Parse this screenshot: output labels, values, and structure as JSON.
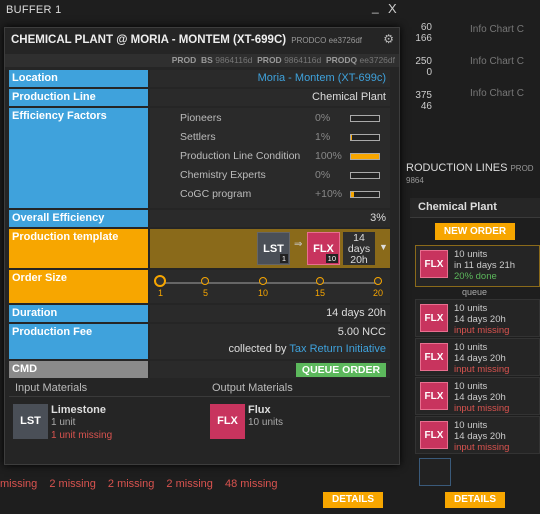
{
  "buffer": {
    "title": "BUFFER 1",
    "minimize": "_",
    "close": "X"
  },
  "window": {
    "title": "CHEMICAL PLANT @ MORIA - MONTEM (XT-699C)",
    "title_tag": "PRODCO ee3726df",
    "id_bar": {
      "prod": "PROD",
      "bs": "BS",
      "bs_id": "9864116d",
      "prod2": "PROD",
      "prod_id": "9864116d",
      "prodq": "PRODQ",
      "prodq_id": "ee3726df"
    }
  },
  "location": {
    "label": "Location",
    "value": "Moria - Montem (XT-699c)"
  },
  "production_line": {
    "label": "Production Line",
    "value": "Chemical Plant"
  },
  "efficiency": {
    "label": "Efficiency Factors",
    "items": [
      {
        "name": "Pioneers",
        "pct": "0%",
        "fill": 0
      },
      {
        "name": "Settlers",
        "pct": "1%",
        "fill": 0.01
      },
      {
        "name": "Production Line Condition",
        "pct": "100%",
        "fill": 1.0
      },
      {
        "name": "Chemistry Experts",
        "pct": "0%",
        "fill": 0
      },
      {
        "name": "CoGC program",
        "pct": "+10%",
        "fill": 0.1
      }
    ]
  },
  "overall": {
    "label": "Overall Efficiency",
    "value": "3%"
  },
  "template": {
    "label": "Production template",
    "input": {
      "ticker": "LST",
      "count": "1",
      "color": "#4a4f57"
    },
    "arrow": "⇒",
    "output": {
      "ticker": "FLX",
      "count": "10",
      "color": "#c8345e"
    },
    "time": "14 days 20h",
    "dropdown": "▼"
  },
  "order_size": {
    "label": "Order Size",
    "stops": [
      "1",
      "5",
      "10",
      "15",
      "20"
    ],
    "selected_index": 0
  },
  "duration": {
    "label": "Duration",
    "value": "14 days 20h"
  },
  "fee": {
    "label": "Production Fee",
    "value": "5.00 NCC",
    "collected_by": "collected by",
    "collector": "Tax Return Initiative"
  },
  "cmd": {
    "label": "CMD",
    "button": "QUEUE ORDER"
  },
  "materials": {
    "input_header": "Input Materials",
    "output_header": "Output Materials",
    "input": {
      "ticker": "LST",
      "name": "Limestone",
      "units": "1 unit",
      "missing": "1 unit missing",
      "color": "#4a4f57"
    },
    "output": {
      "ticker": "FLX",
      "name": "Flux",
      "units": "10 units",
      "color": "#c8345e"
    }
  },
  "background": {
    "numbers": [
      "60",
      "166",
      "",
      "250",
      "0",
      "",
      "375",
      "46"
    ],
    "info_rows": [
      "Info Chart C",
      "Info Chart C",
      "Info Chart C"
    ],
    "panel_title": "RODUCTION LINES",
    "panel_tag": "PROD 9864",
    "column": "Chemical Plant",
    "new_order": "NEW ORDER",
    "queue_label": "queue",
    "orders": [
      {
        "ticker": "FLX",
        "l1": "10 units",
        "l2": "in 11 days 21h",
        "l3": "20% done",
        "l3_type": "grn"
      },
      {
        "ticker": "FLX",
        "l1": "10 units",
        "l2": "14 days 20h",
        "l3": "input missing",
        "l3_type": "red"
      },
      {
        "ticker": "FLX",
        "l1": "10 units",
        "l2": "14 days 20h",
        "l3": "input missing",
        "l3_type": "red"
      },
      {
        "ticker": "FLX",
        "l1": "10 units",
        "l2": "14 days 20h",
        "l3": "input missing",
        "l3_type": "red"
      },
      {
        "ticker": "FLX",
        "l1": "10 units",
        "l2": "14 days 20h",
        "l3": "input missing",
        "l3_type": "red"
      }
    ],
    "details": [
      "DETAILS",
      "DETAILS"
    ],
    "missing_row": [
      "missing",
      "2 missing",
      "2 missing",
      "2 missing",
      "48 missing"
    ]
  }
}
